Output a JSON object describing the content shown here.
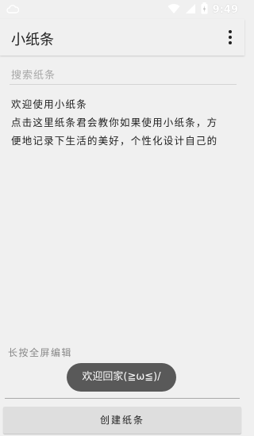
{
  "status_bar": {
    "time": "9:49",
    "icons": [
      "cloud-icon",
      "wifi-icon",
      "signal-icon",
      "battery-icon"
    ]
  },
  "app": {
    "title": "小纸条",
    "menu_icon": "overflow-menu-icon"
  },
  "search": {
    "placeholder": "搜索纸条"
  },
  "note": {
    "line1": "欢迎使用小纸条",
    "line2": "点击这里纸条君会教你如果使用小纸条，方",
    "line3": "便地记录下生活的美好，个性化设计自己的"
  },
  "hint": "长按全屏编辑",
  "toast": "欢迎回家(≧ω≦)/",
  "create_button": "创建纸条"
}
